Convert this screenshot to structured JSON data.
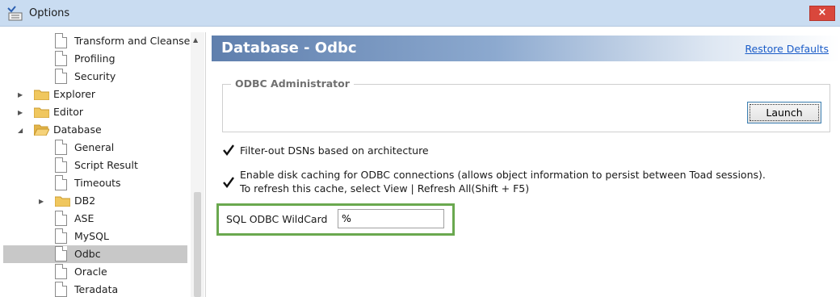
{
  "window": {
    "title": "Options",
    "close_glyph": "×"
  },
  "tree": {
    "items": [
      {
        "label": "Transform and Cleanse",
        "type": "doc",
        "level": 2
      },
      {
        "label": "Profiling",
        "type": "doc",
        "level": 2
      },
      {
        "label": "Security",
        "type": "doc",
        "level": 2
      },
      {
        "label": "Explorer",
        "type": "folder",
        "level": 1,
        "state": "collapsed"
      },
      {
        "label": "Editor",
        "type": "folder",
        "level": 1,
        "state": "collapsed"
      },
      {
        "label": "Database",
        "type": "folder",
        "level": 1,
        "state": "expanded"
      },
      {
        "label": "General",
        "type": "doc",
        "level": 2
      },
      {
        "label": "Script Result",
        "type": "doc",
        "level": 2
      },
      {
        "label": "Timeouts",
        "type": "doc",
        "level": 2
      },
      {
        "label": "DB2",
        "type": "folder",
        "level": 2,
        "state": "collapsed"
      },
      {
        "label": "ASE",
        "type": "doc",
        "level": 2
      },
      {
        "label": "MySQL",
        "type": "doc",
        "level": 2
      },
      {
        "label": "Odbc",
        "type": "doc",
        "level": 2,
        "selected": true
      },
      {
        "label": "Oracle",
        "type": "doc",
        "level": 2
      },
      {
        "label": "Teradata",
        "type": "doc",
        "level": 2
      }
    ]
  },
  "panel": {
    "title": "Database - Odbc",
    "restore_defaults": "Restore Defaults",
    "odbc_group": {
      "title": "ODBC Administrator",
      "launch_label": "Launch"
    },
    "options": {
      "filter_dsn": {
        "label": "Filter-out DSNs based on architecture",
        "checked": true
      },
      "disk_cache": {
        "line1": "Enable disk caching for ODBC connections (allows object information to persist between Toad sessions).",
        "line2": "To refresh this cache, select View | Refresh All(Shift + F5)",
        "checked": true
      }
    },
    "wildcard": {
      "label": "SQL ODBC WildCard",
      "value": "%"
    }
  },
  "colors": {
    "highlight_border": "#6aa84f",
    "close_button": "#d9473c",
    "link": "#1a5cc8"
  }
}
